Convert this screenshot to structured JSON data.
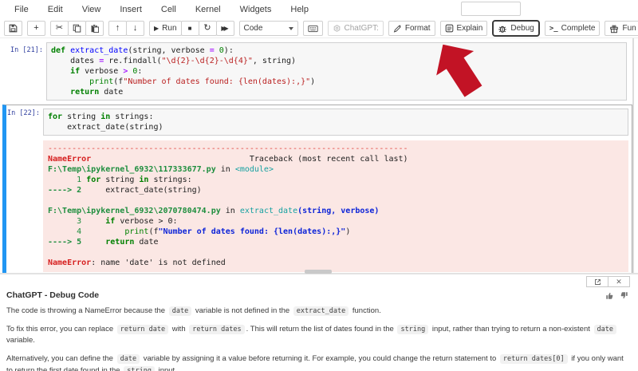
{
  "menu": {
    "items": [
      "File",
      "Edit",
      "View",
      "Insert",
      "Cell",
      "Kernel",
      "Widgets",
      "Help"
    ]
  },
  "toolbar": {
    "run_label": "Run",
    "cell_type": "Code",
    "chatgpt_label": "ChatGPT:",
    "format_label": "Format",
    "explain_label": "Explain",
    "debug_label": "Debug",
    "complete_label": "Complete",
    "fun_label": "Fun",
    "complete_icon": ">_"
  },
  "colors": {
    "accent_blue": "#2196f3",
    "error_bg": "#fbe7e4",
    "arrow_red": "#c21325",
    "prompt_blue": "#303f9f"
  },
  "cells": [
    {
      "prompt": "In [21]:",
      "lines": [
        [
          [
            "k",
            "def"
          ],
          [
            "t",
            " "
          ],
          [
            "f",
            "extract_date"
          ],
          [
            "t",
            "(string, verbose "
          ],
          [
            "o",
            "="
          ],
          [
            "t",
            " "
          ],
          [
            "n",
            "0"
          ],
          [
            "t",
            "):"
          ]
        ],
        [
          [
            "t",
            "    dates "
          ],
          [
            "o",
            "="
          ],
          [
            "t",
            " re.findall("
          ],
          [
            "s",
            "\"\\d{2}-\\d{2}-\\d{4}\""
          ],
          [
            "t",
            ", string)"
          ]
        ],
        [
          [
            "t",
            "    "
          ],
          [
            "k",
            "if"
          ],
          [
            "t",
            " verbose "
          ],
          [
            "o",
            ">"
          ],
          [
            "t",
            " "
          ],
          [
            "n",
            "0"
          ],
          [
            "t",
            ":"
          ]
        ],
        [
          [
            "t",
            "        "
          ],
          [
            "b",
            "print"
          ],
          [
            "t",
            "(f"
          ],
          [
            "s",
            "\"Number of dates found: {len(dates):,}\""
          ],
          [
            "t",
            ")"
          ]
        ],
        [
          [
            "t",
            "    "
          ],
          [
            "k",
            "return"
          ],
          [
            "t",
            " date"
          ]
        ]
      ]
    },
    {
      "prompt": "In [22]:",
      "lines": [
        [
          [
            "k",
            "for"
          ],
          [
            "t",
            " string "
          ],
          [
            "k",
            "in"
          ],
          [
            "t",
            " strings:"
          ]
        ],
        [
          [
            "t",
            "    extract_date(string)"
          ]
        ]
      ],
      "error_lines": [
        [
          [
            "d",
            "---------------------------------------------------------------------------"
          ]
        ],
        [
          [
            "eb",
            "NameError"
          ],
          [
            "t",
            "                                 Traceback (most recent call last)"
          ]
        ],
        [
          [
            "p",
            "F:\\Temp\\ipykernel_6932\\117333677.py"
          ],
          [
            "t",
            " in "
          ],
          [
            "m",
            "<module>"
          ]
        ],
        [
          [
            "ln",
            "      1 "
          ],
          [
            "k",
            "for"
          ],
          [
            "t",
            " string "
          ],
          [
            "k",
            "in"
          ],
          [
            "t",
            " strings:"
          ]
        ],
        [
          [
            "ar",
            "----> 2"
          ],
          [
            "t",
            "     extract_date(string)"
          ]
        ],
        [
          [
            "t",
            ""
          ]
        ],
        [
          [
            "p",
            "F:\\Temp\\ipykernel_6932\\2070780474.py"
          ],
          [
            "t",
            " in "
          ],
          [
            "m",
            "extract_date"
          ],
          [
            "pb",
            "(string, verbose)"
          ]
        ],
        [
          [
            "ln",
            "      3 "
          ],
          [
            "t",
            "    "
          ],
          [
            "k",
            "if"
          ],
          [
            "t",
            " verbose > 0:"
          ]
        ],
        [
          [
            "ln",
            "      4 "
          ],
          [
            "t",
            "        "
          ],
          [
            "b",
            "print"
          ],
          [
            "t",
            "(f"
          ],
          [
            "sb",
            "\"Number of dates found: {len(dates):,}\""
          ],
          [
            "t",
            ")"
          ]
        ],
        [
          [
            "ar",
            "----> 5"
          ],
          [
            "t",
            "     "
          ],
          [
            "k",
            "return"
          ],
          [
            "t",
            " date"
          ]
        ],
        [
          [
            "t",
            ""
          ]
        ],
        [
          [
            "eb",
            "NameError"
          ],
          [
            "t",
            ": name 'date' is not defined"
          ]
        ]
      ]
    }
  ],
  "panel": {
    "title": "ChatGPT - Debug Code",
    "paragraphs": [
      [
        {
          "t": "The code is throwing a NameError because the "
        },
        {
          "c": "date"
        },
        {
          "t": " variable is not defined in the "
        },
        {
          "c": "extract_date"
        },
        {
          "t": " function."
        }
      ],
      [
        {
          "t": "To fix this error, you can replace "
        },
        {
          "c": "return date"
        },
        {
          "t": " with "
        },
        {
          "c": "return dates"
        },
        {
          "t": ". This will return the list of dates found in the "
        },
        {
          "c": "string"
        },
        {
          "t": " input, rather than trying to return a non-existent "
        },
        {
          "c": "date"
        },
        {
          "t": " variable."
        }
      ],
      [
        {
          "t": "Alternatively, you can define the "
        },
        {
          "c": "date"
        },
        {
          "t": " variable by assigning it a value before returning it. For example, you could change the return statement to "
        },
        {
          "c": "return dates[0]"
        },
        {
          "t": " if you only want to return the first date found in the "
        },
        {
          "c": "string"
        },
        {
          "t": " input."
        }
      ]
    ]
  }
}
